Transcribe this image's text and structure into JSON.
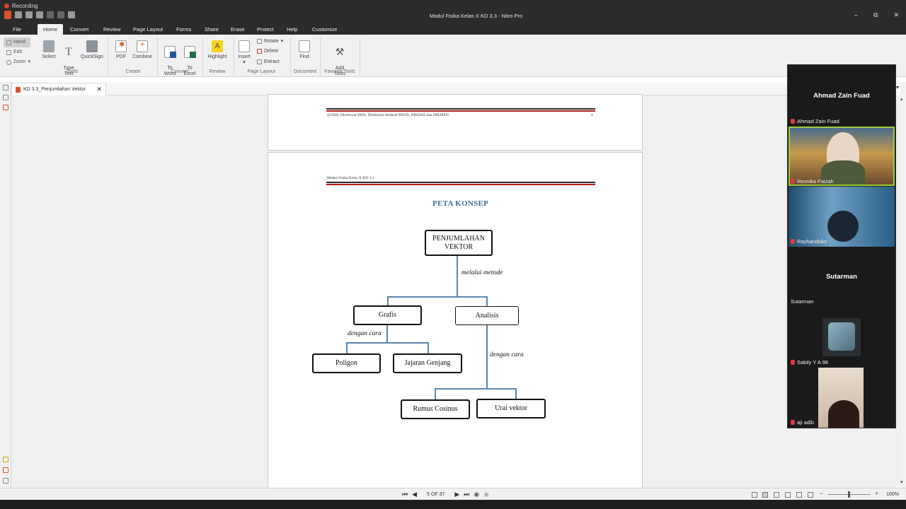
{
  "titlebar": {
    "recording_label": "Recording",
    "window_title": "Modul Fisika Kelas X KD 3.3 - Nitro Pro",
    "minimize": "–",
    "maximize": "⧉",
    "close": "✕"
  },
  "menu": {
    "file": "File",
    "home": "Home",
    "convert": "Convert",
    "review": "Review",
    "page_layout": "Page Layout",
    "forms": "Forms",
    "share": "Share",
    "erase": "Erase",
    "protect": "Protect",
    "help": "Help",
    "customize": "Customize"
  },
  "ribbon": {
    "hand": "Hand",
    "edit": "Edit",
    "zoom": "Zoom",
    "select": "Select",
    "type_text": "Type\nText",
    "quicksign": "QuickSign",
    "pdf": "PDF",
    "combine": "Combine",
    "to_word": "To\nWord",
    "to_excel": "To\nExcel",
    "highlight": "Highlight",
    "insert": "Insert",
    "rotate": "Rotate",
    "delete": "Delete",
    "extract": "Extract",
    "find": "Find",
    "add_tools": "Add\nTools",
    "groups": {
      "tools": "Tools",
      "create": "Create",
      "convert": "Convert",
      "review": "Review",
      "page_layout": "Page Layout",
      "document": "Document",
      "favorite_tools": "Favorite Tools"
    }
  },
  "document_tab": {
    "name": "KD 3.3_Penjumlahan Vektor",
    "close": "✕"
  },
  "page_prev": {
    "footer_text": "@2020, Direktorat SMA, Direktorat Jenderal PAUD, DIKDAS dan DIKMEN",
    "page_number": "4"
  },
  "page_current": {
    "header_text": "Modul Fisika Kelas X KD 3.3",
    "title": "PETA KONSEP",
    "root_box": "PENJUMLAHAN VEKTOR",
    "method_label": "melalui metode",
    "grafis": "Grafis",
    "analisis": "Analisis",
    "grafis_way": "dengan cara",
    "analisis_way": "dengan cara",
    "poligon": "Poligon",
    "jajaran_genjang": "Jajaran Genjang",
    "rumus_cosinus": "Rumus Cosinus",
    "urai_vektor": "Urai vektor"
  },
  "statusbar": {
    "page_indicator": "5 OF 37",
    "zoom_level": "100%"
  },
  "zoom_panel": {
    "participants": [
      {
        "big_name": "Ahmad Zain Fuad",
        "tag": "Ahmad Zain Fuad"
      },
      {
        "tag": "Revnika Faizah"
      },
      {
        "tag": "Rayhandoko"
      },
      {
        "big_name": "Sutarman",
        "tag": "Sutarman"
      },
      {
        "tag": "Sabily Y A 98"
      },
      {
        "tag": "aji adib"
      }
    ]
  },
  "colors": {
    "accent_title": "#3d6f95",
    "connector": "#5b86b0",
    "header_red": "#b11c1c",
    "nitro_orange": "#d9532b"
  }
}
